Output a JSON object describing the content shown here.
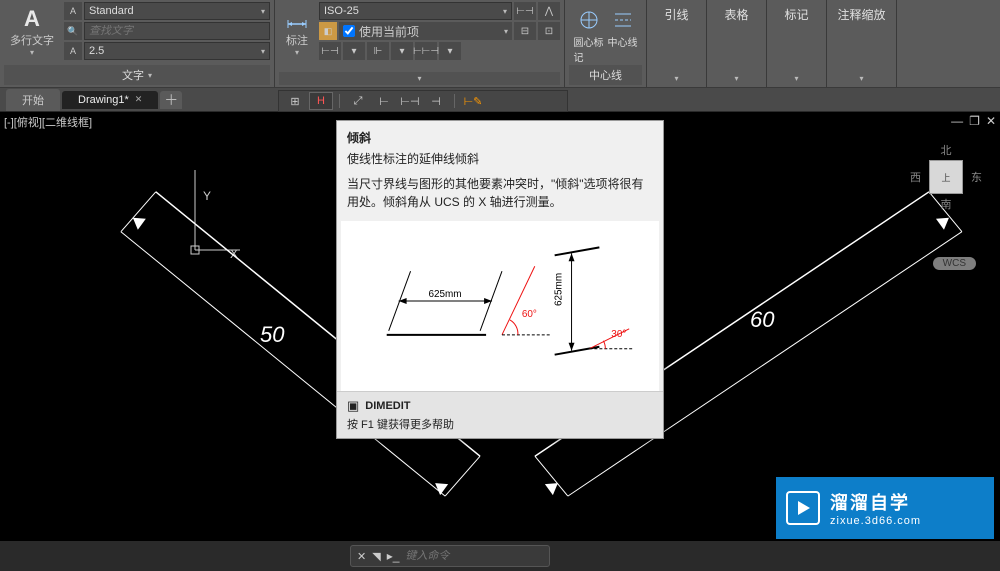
{
  "ribbon": {
    "text_panel": {
      "big_button": "多行文字",
      "style_dd": "Standard",
      "search_placeholder": "查找文字",
      "height_dd": "2.5",
      "title": "文字"
    },
    "dim_panel": {
      "label": "标注",
      "style_dd": "ISO-25",
      "use_current_label": "使用当前项"
    },
    "center_panel": {
      "circlelabel": "圆心标记",
      "centerlabel": "中心线",
      "title": "中心线"
    },
    "leader": "引线",
    "table": "表格",
    "mark": "标记",
    "annoscale": "注释缩放"
  },
  "tabs": {
    "start": "开始",
    "drawing": "Drawing1*"
  },
  "viewport": {
    "label": "[-][俯视][二维线框]",
    "ucs_x": "X",
    "ucs_y": "Y",
    "dim50": "50",
    "dim60": "60",
    "wcs": "WCS",
    "viewcube": {
      "n": "北",
      "s": "南",
      "e": "东",
      "w": "西",
      "face": "上"
    }
  },
  "tooltip": {
    "title": "倾斜",
    "subtitle": "使线性标注的延伸线倾斜",
    "body": "当尺寸界线与图形的其他要素冲突时，\"倾斜\"选项将很有用处。倾斜角从 UCS 的 X 轴进行测量。",
    "diag": {
      "len": "625mm",
      "ang1": "60°",
      "ang2": "30°",
      "len2": "625mm"
    },
    "cmd": "DIMEDIT",
    "help": "按 F1 键获得更多帮助"
  },
  "cmdline": {
    "placeholder": "键入命令"
  },
  "watermark": {
    "cn": "溜溜自学",
    "url": "zixue.3d66.com"
  }
}
